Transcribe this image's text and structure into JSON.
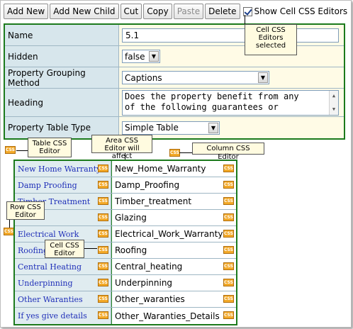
{
  "toolbar": {
    "buttons": [
      "Add New",
      "Add New Child",
      "Cut",
      "Copy",
      "Paste",
      "Delete"
    ],
    "show_css_label": "Show Cell CSS Editors"
  },
  "properties": {
    "name": {
      "label": "Name",
      "value": "5.1"
    },
    "hidden": {
      "label": "Hidden",
      "value": "false"
    },
    "grouping": {
      "label": "Property Grouping Method",
      "value": "Captions"
    },
    "heading": {
      "label": "Heading",
      "value_line1": "Does the property benefit from any",
      "value_line2": "of the following guarantees or"
    },
    "table_type": {
      "label": "Property Table Type",
      "value": "Simple Table"
    }
  },
  "css_badge": "CSS",
  "callouts": {
    "cell_css_selected": "Cell CSS Editors selected",
    "table_css": "Table CSS Editor",
    "area_css": "Area CSS Editor will affect",
    "column_css": "Column CSS Editor",
    "row_css": "Row CSS Editor",
    "cell_css": "Cell CSS Editor"
  },
  "table_rows": [
    {
      "label": "New Home Warranty",
      "value": "New_Home_Warranty"
    },
    {
      "label": "Damp Proofing",
      "value": "Damp_Proofing"
    },
    {
      "label": "Timber Treatment",
      "value": "Timber_treatment"
    },
    {
      "label": "",
      "value": "Glazing"
    },
    {
      "label": "Electrical Work",
      "value": "Electrical_Work_Warranty"
    },
    {
      "label": "Roofing",
      "value": "Roofing"
    },
    {
      "label": "Central Heating",
      "value": "Central_heating"
    },
    {
      "label": "Underpinning",
      "value": "Underpinning"
    },
    {
      "label": "Other Waranties",
      "value": "Other_waranties"
    },
    {
      "label": "If yes give details",
      "value": "Other_Waranties_Details"
    }
  ],
  "colors": {
    "grid_border": "#1c7a1c",
    "label_bg": "#d7e6ec",
    "value_bg": "#fffbe6",
    "link_text": "#1f2fb8",
    "css_badge": "#f3a928"
  }
}
